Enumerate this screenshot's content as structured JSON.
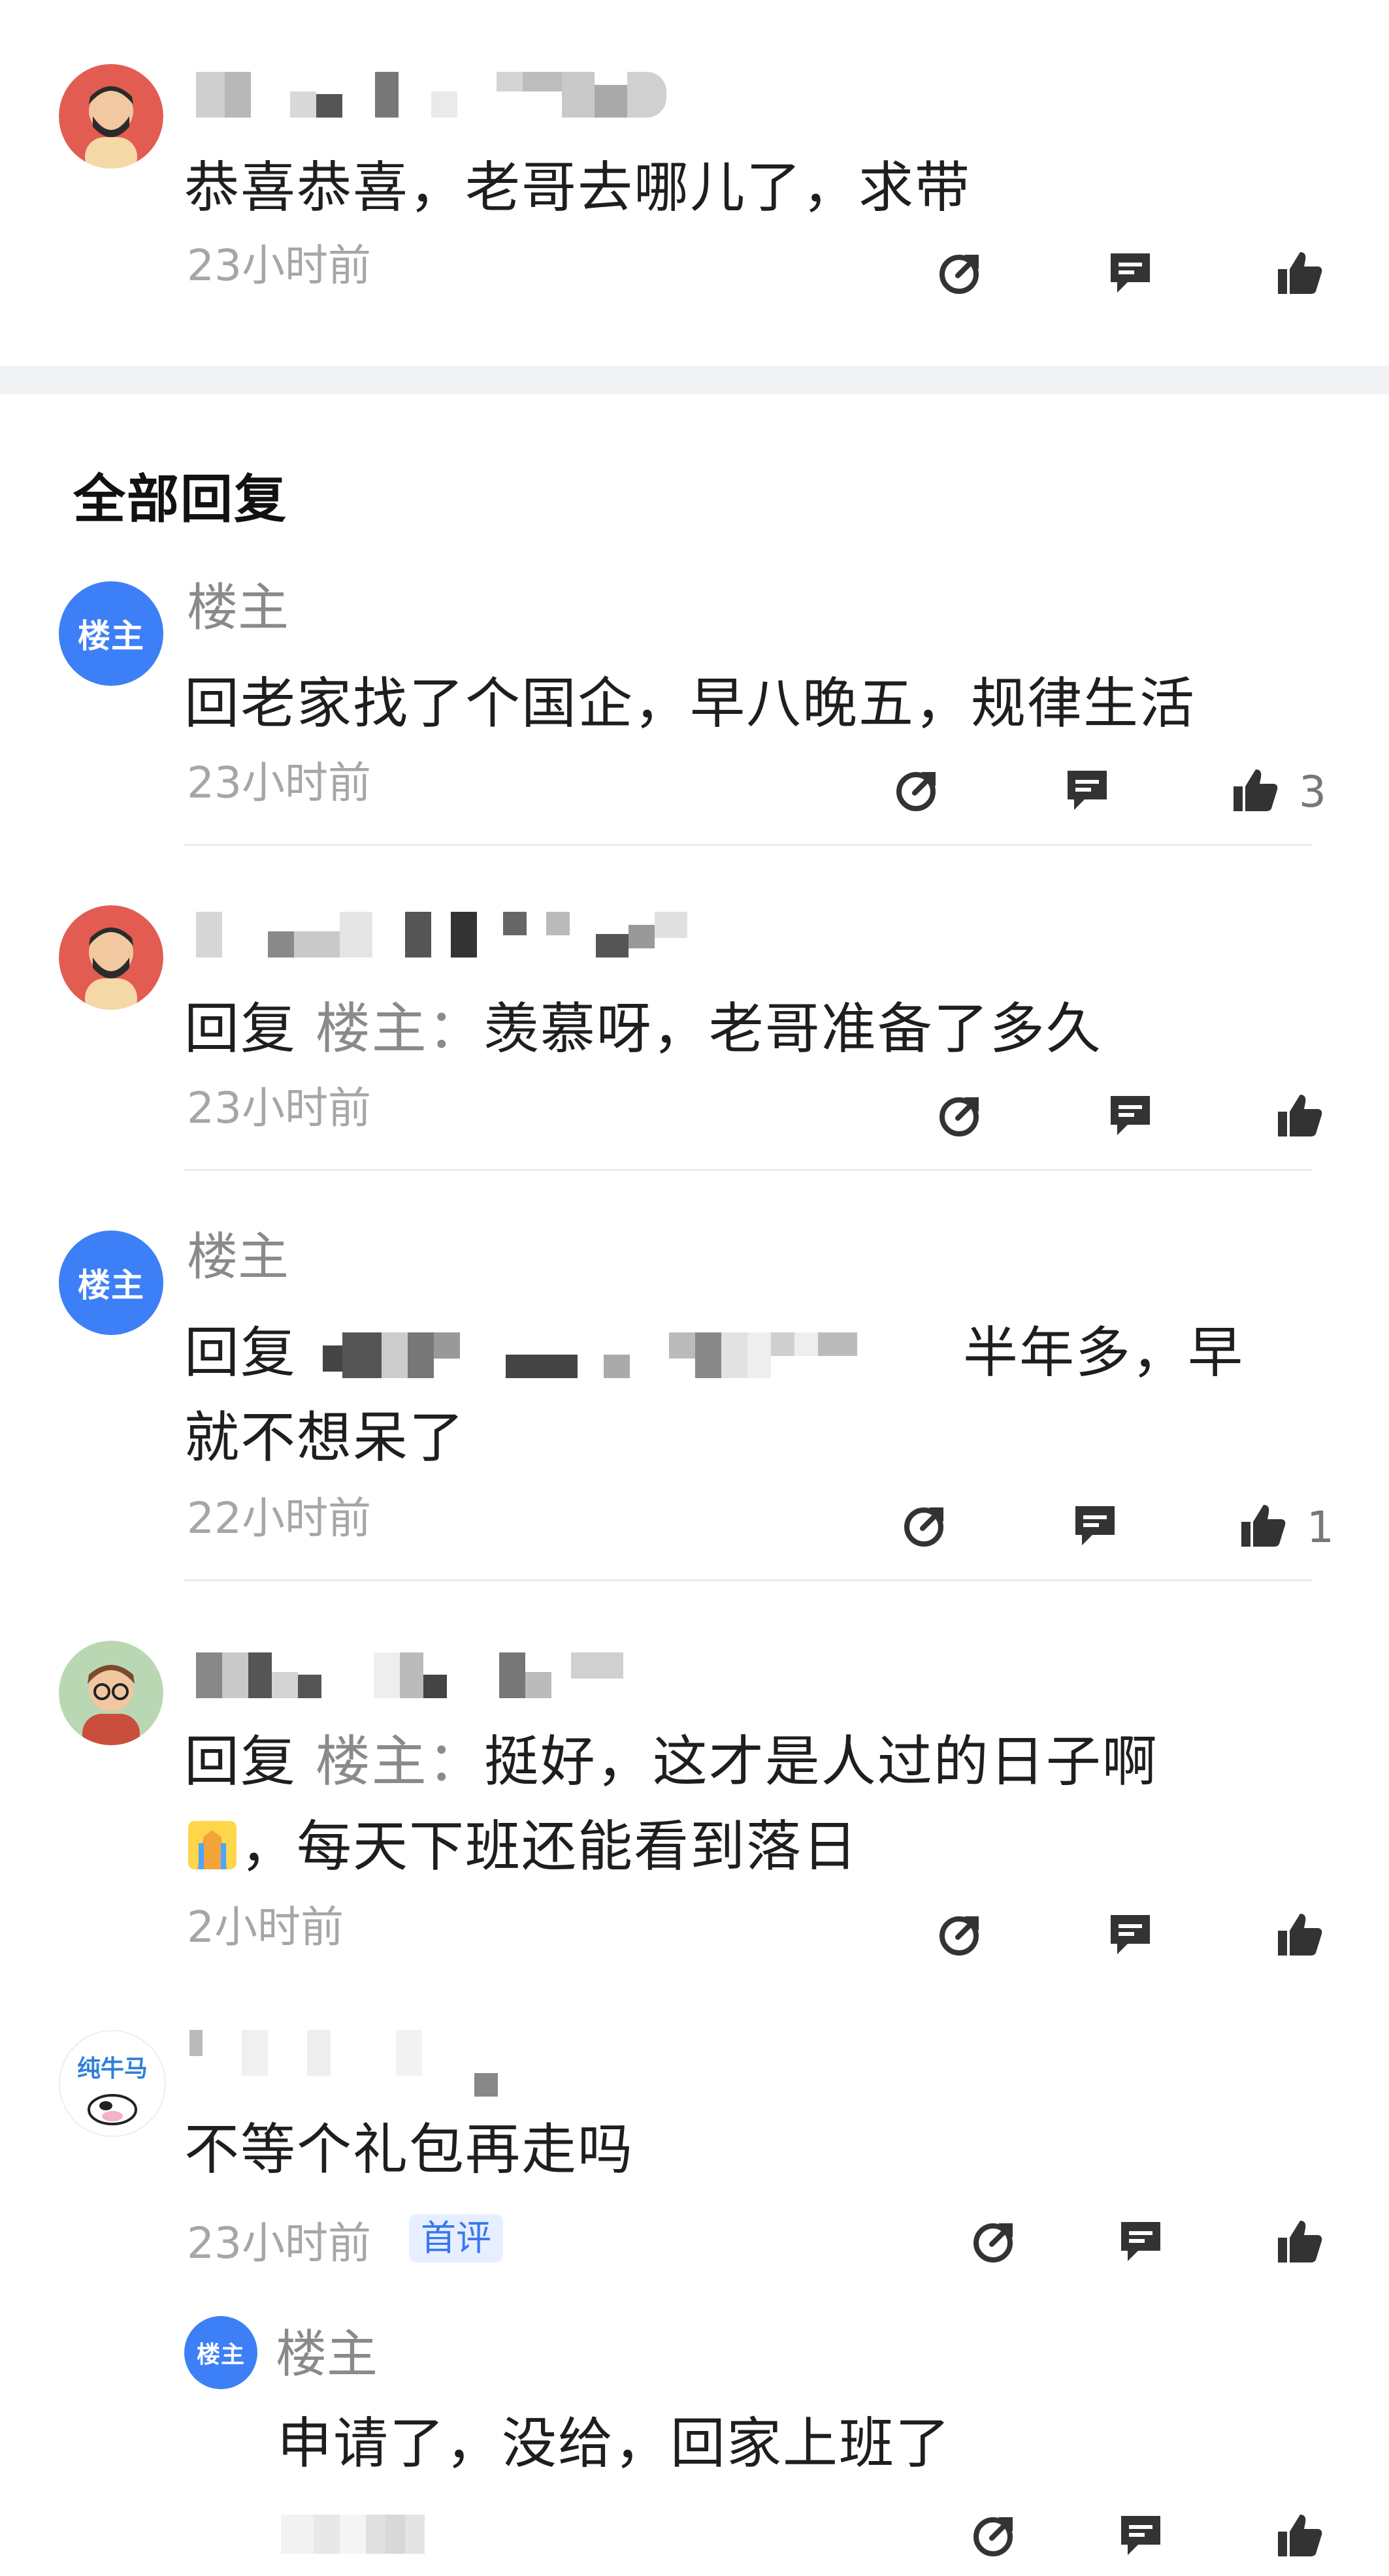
{
  "top_comment": {
    "content": "恭喜恭喜，老哥去哪儿了，求带",
    "time": "23小时前"
  },
  "section": {
    "title": "全部回复"
  },
  "replies": [
    {
      "author": "楼主",
      "content": "回老家找了个国企，早八晚五，规律生活",
      "time": "23小时前",
      "likes": "3"
    },
    {
      "prefix": "回复",
      "target": "楼主：",
      "content": "羡慕呀，老哥准备了多久",
      "time": "23小时前"
    },
    {
      "author": "楼主",
      "prefix": "回复",
      "content_line1": "半年多，早",
      "content_line2": "就不想呆了",
      "time": "22小时前",
      "likes": "1"
    },
    {
      "prefix": "回复",
      "target": "楼主：",
      "content_line1": "挺好，这才是人过的日子啊",
      "content_line2": "，每天下班还能看到落日",
      "time": "2小时前"
    },
    {
      "avatar_text": "纯牛马",
      "content": "不等个礼包再走吗",
      "time": "23小时前",
      "badge": "首评"
    }
  ],
  "nested_reply": {
    "author": "楼主",
    "content": "申请了，没给，回家上班了"
  },
  "host_avatar_label": "楼主",
  "colors": {
    "accent": "#3d7ff6",
    "text": "#1e1e1e",
    "muted": "#8a8a8a"
  }
}
